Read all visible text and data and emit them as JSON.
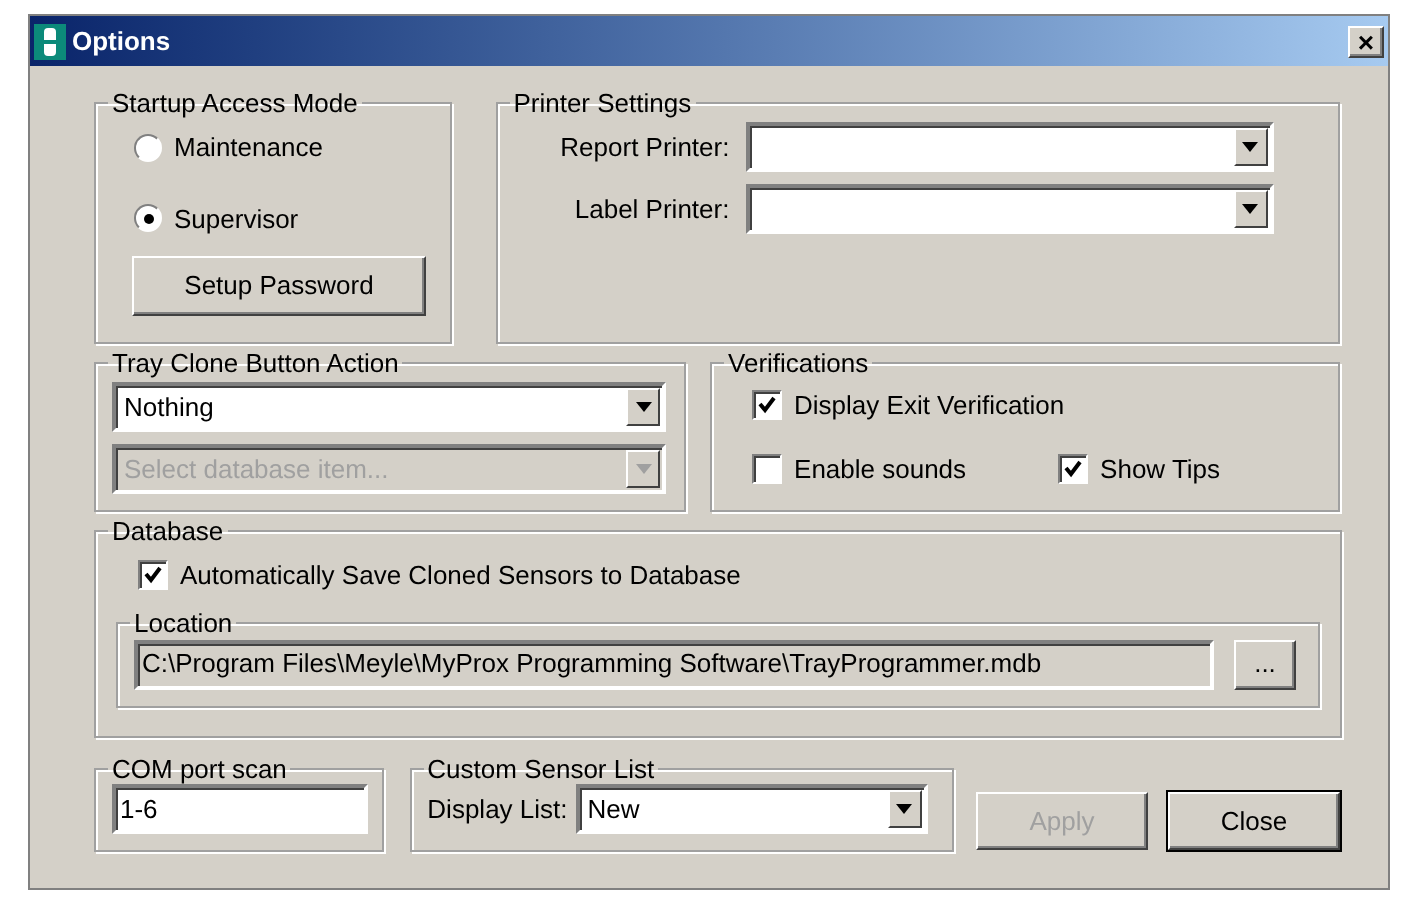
{
  "window": {
    "title": "Options",
    "close": "×"
  },
  "startup_access_mode": {
    "title": "Startup Access Mode",
    "options": [
      {
        "label": "Maintenance",
        "selected": false
      },
      {
        "label": "Supervisor",
        "selected": true
      }
    ],
    "button": "Setup Password"
  },
  "printer_settings": {
    "title": "Printer Settings",
    "fields": [
      {
        "label": "Report Printer:"
      },
      {
        "label": "Label Printer:"
      }
    ]
  },
  "tray_clone_button_action": {
    "title": "Tray Clone Button Action",
    "action": {
      "value": "Nothing",
      "disabled": false
    },
    "database_item": {
      "placeholder": "Select database item...",
      "disabled": true
    }
  },
  "verifications": {
    "title": "Verifications",
    "checkboxes": [
      {
        "label": "Display Exit Verification",
        "checked": true
      },
      {
        "label": "Enable sounds",
        "checked": false
      },
      {
        "label": "Show Tips",
        "checked": true
      }
    ]
  },
  "database": {
    "title": "Database",
    "auto_save": {
      "label": "Automatically Save Cloned Sensors to Database",
      "checked": true
    },
    "location": {
      "title": "Location",
      "value": "C:\\Program Files\\Meyle\\MyProx Programming Software\\TrayProgrammer.mdb",
      "browse": "..."
    }
  },
  "com_port_scan": {
    "title": "COM port scan",
    "value": "1-6"
  },
  "custom_sensor_list": {
    "title": "Custom Sensor List",
    "label": "Display List:",
    "value": "New"
  },
  "buttons": [
    {
      "label": "Apply",
      "disabled": true,
      "default": false
    },
    {
      "label": "Close",
      "disabled": false,
      "default": true
    }
  ]
}
